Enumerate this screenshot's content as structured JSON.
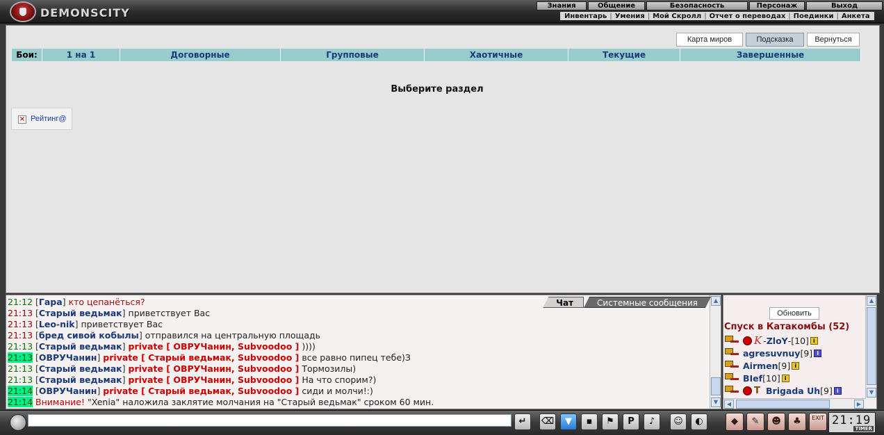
{
  "app": {
    "logo_text": "DEMONSCITY"
  },
  "nav": {
    "main": [
      "Знания",
      "Общение",
      "Безопасность",
      "Персонаж",
      "Выход"
    ],
    "sub": [
      "Инвентарь",
      "Умения",
      "Мой Скролл",
      "Отчет о переводах",
      "Поединки",
      "Анкета"
    ]
  },
  "top_buttons": {
    "map": "Карта миров",
    "hint": "Подсказка",
    "back": "Вернуться"
  },
  "battle_tabs": [
    "Бои:",
    "1 на 1",
    "Договорные",
    "Групповые",
    "Хаотичные",
    "Текущие",
    "Завершенные"
  ],
  "section_title": "Выберите раздел",
  "rating_link": "Рейтинг@",
  "chat": {
    "tabs": {
      "chat": "Чат",
      "system": "Системные сообщения"
    },
    "lines": [
      {
        "time": "21:12",
        "time_style": "green",
        "nick": "Гара",
        "private": "",
        "text": "кто цепанёться?",
        "text_style": "red"
      },
      {
        "time": "21:13",
        "time_style": "red",
        "nick": "Старый ведьмак",
        "private": "",
        "text": "приветствует Вас",
        "text_style": "normal"
      },
      {
        "time": "21:13",
        "time_style": "red",
        "nick": "Leo-nik",
        "private": "",
        "text": "приветствует Вас",
        "text_style": "normal"
      },
      {
        "time": "21:13",
        "time_style": "red",
        "nick": "бред сивой кобылы",
        "private": "",
        "text": "отправился на центральную площадь",
        "text_style": "normal"
      },
      {
        "time": "21:13",
        "time_style": "green",
        "nick": "Старый ведьмак",
        "private": "private [ ОВРУЧанин, Subvoodoo ]",
        "text": "))))",
        "text_style": "normal"
      },
      {
        "time": "21:13",
        "time_style": "highlight",
        "nick": "ОВРУЧанин",
        "private": "private [ Старый ведьмак, Subvoodoo ]",
        "text": "все равно пипец тебе)З",
        "text_style": "normal"
      },
      {
        "time": "21:13",
        "time_style": "green",
        "nick": "Старый ведьмак",
        "private": "private [ ОВРУЧанин, Subvoodoo ]",
        "text": "Тормозилы)",
        "text_style": "normal"
      },
      {
        "time": "21:13",
        "time_style": "green",
        "nick": "Старый ведьмак",
        "private": "private [ ОВРУЧанин, Subvoodoo ]",
        "text": "На что спорим?)",
        "text_style": "normal"
      },
      {
        "time": "21:14",
        "time_style": "highlight",
        "nick": "ОВРУЧанин",
        "private": "private [ Старый ведьмак, Subvoodoo ]",
        "text": "сиди и молчи!:)",
        "text_style": "normal"
      },
      {
        "time": "21:14",
        "time_style": "highlight",
        "nick": "",
        "private": "",
        "attention": "Внимание!",
        "text": "\"Xenia\" наложила заклятие молчания на \"Старый ведьмак\" сроком 60 мин.",
        "text_style": "normal"
      }
    ]
  },
  "players": {
    "refresh": "Обновить",
    "room_title": "Спуск в Катакомбы (52)",
    "list": [
      {
        "clan": "red",
        "prefix": "K",
        "name": "ZloY",
        "level": "[10]",
        "info": "yellow",
        "pre_dash": true
      },
      {
        "clan": "",
        "prefix": "",
        "name": "agresuvnuy",
        "level": "[9]",
        "info": "blue",
        "pre_dash": false
      },
      {
        "clan": "",
        "prefix": "",
        "name": "Airmen",
        "level": "[9]",
        "info": "yellow",
        "pre_dash": false
      },
      {
        "clan": "",
        "prefix": "",
        "name": "BIef",
        "level": "[10]",
        "info": "yellow",
        "pre_dash": false
      },
      {
        "clan": "red-tau",
        "prefix": "",
        "name": "Brigada Uh",
        "level": "[9]",
        "info": "blue",
        "pre_dash": false
      }
    ]
  },
  "clock": {
    "time": "21:19",
    "label": "TIMER"
  },
  "chat_input": {
    "value": ""
  },
  "toolbar": {
    "exit_label": "EXIT"
  }
}
